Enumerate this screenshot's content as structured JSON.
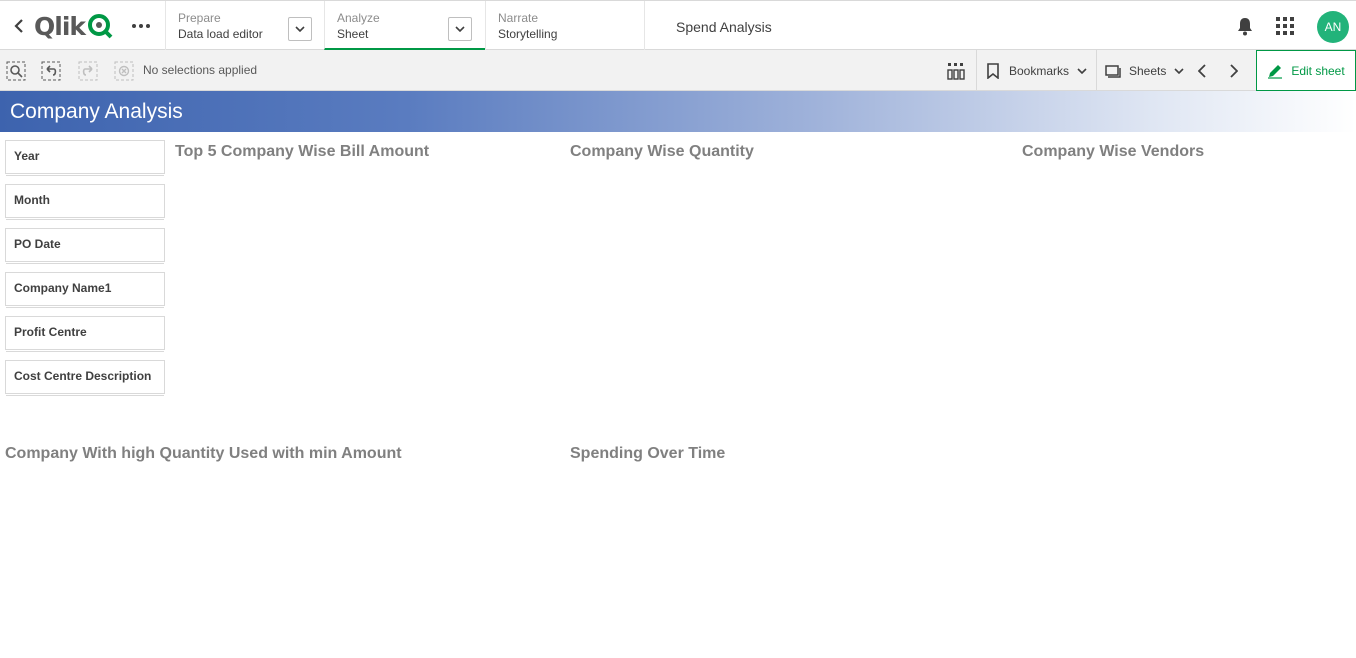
{
  "topbar": {
    "logo_text": "Qlik",
    "tabs": [
      {
        "section": "Prepare",
        "label": "Data load editor"
      },
      {
        "section": "Analyze",
        "label": "Sheet"
      },
      {
        "section": "Narrate",
        "label": "Storytelling"
      }
    ],
    "app_title": "Spend Analysis",
    "avatar_initials": "AN",
    "colors": {
      "accent": "#009845",
      "avatar": "#22b37a"
    }
  },
  "toolbar": {
    "selection_status": "No selections applied",
    "bookmarks_label": "Bookmarks",
    "sheets_label": "Sheets",
    "edit_label": "Edit sheet"
  },
  "sheet": {
    "title": "Company Analysis",
    "filters": [
      "Year",
      "Month",
      "PO Date",
      "Company Name1",
      "Profit Centre",
      "Cost Centre Description"
    ],
    "charts": [
      "Top 5 Company Wise Bill Amount",
      "Company Wise Quantity",
      "Company Wise Vendors",
      "Company With high Quantity Used with min Amount",
      "Spending Over Time"
    ]
  },
  "icons": {
    "back": "chevron-left-icon",
    "more": "ellipsis-icon",
    "bell": "bell-icon",
    "apps": "grid-icon",
    "edit": "pencil-icon"
  }
}
